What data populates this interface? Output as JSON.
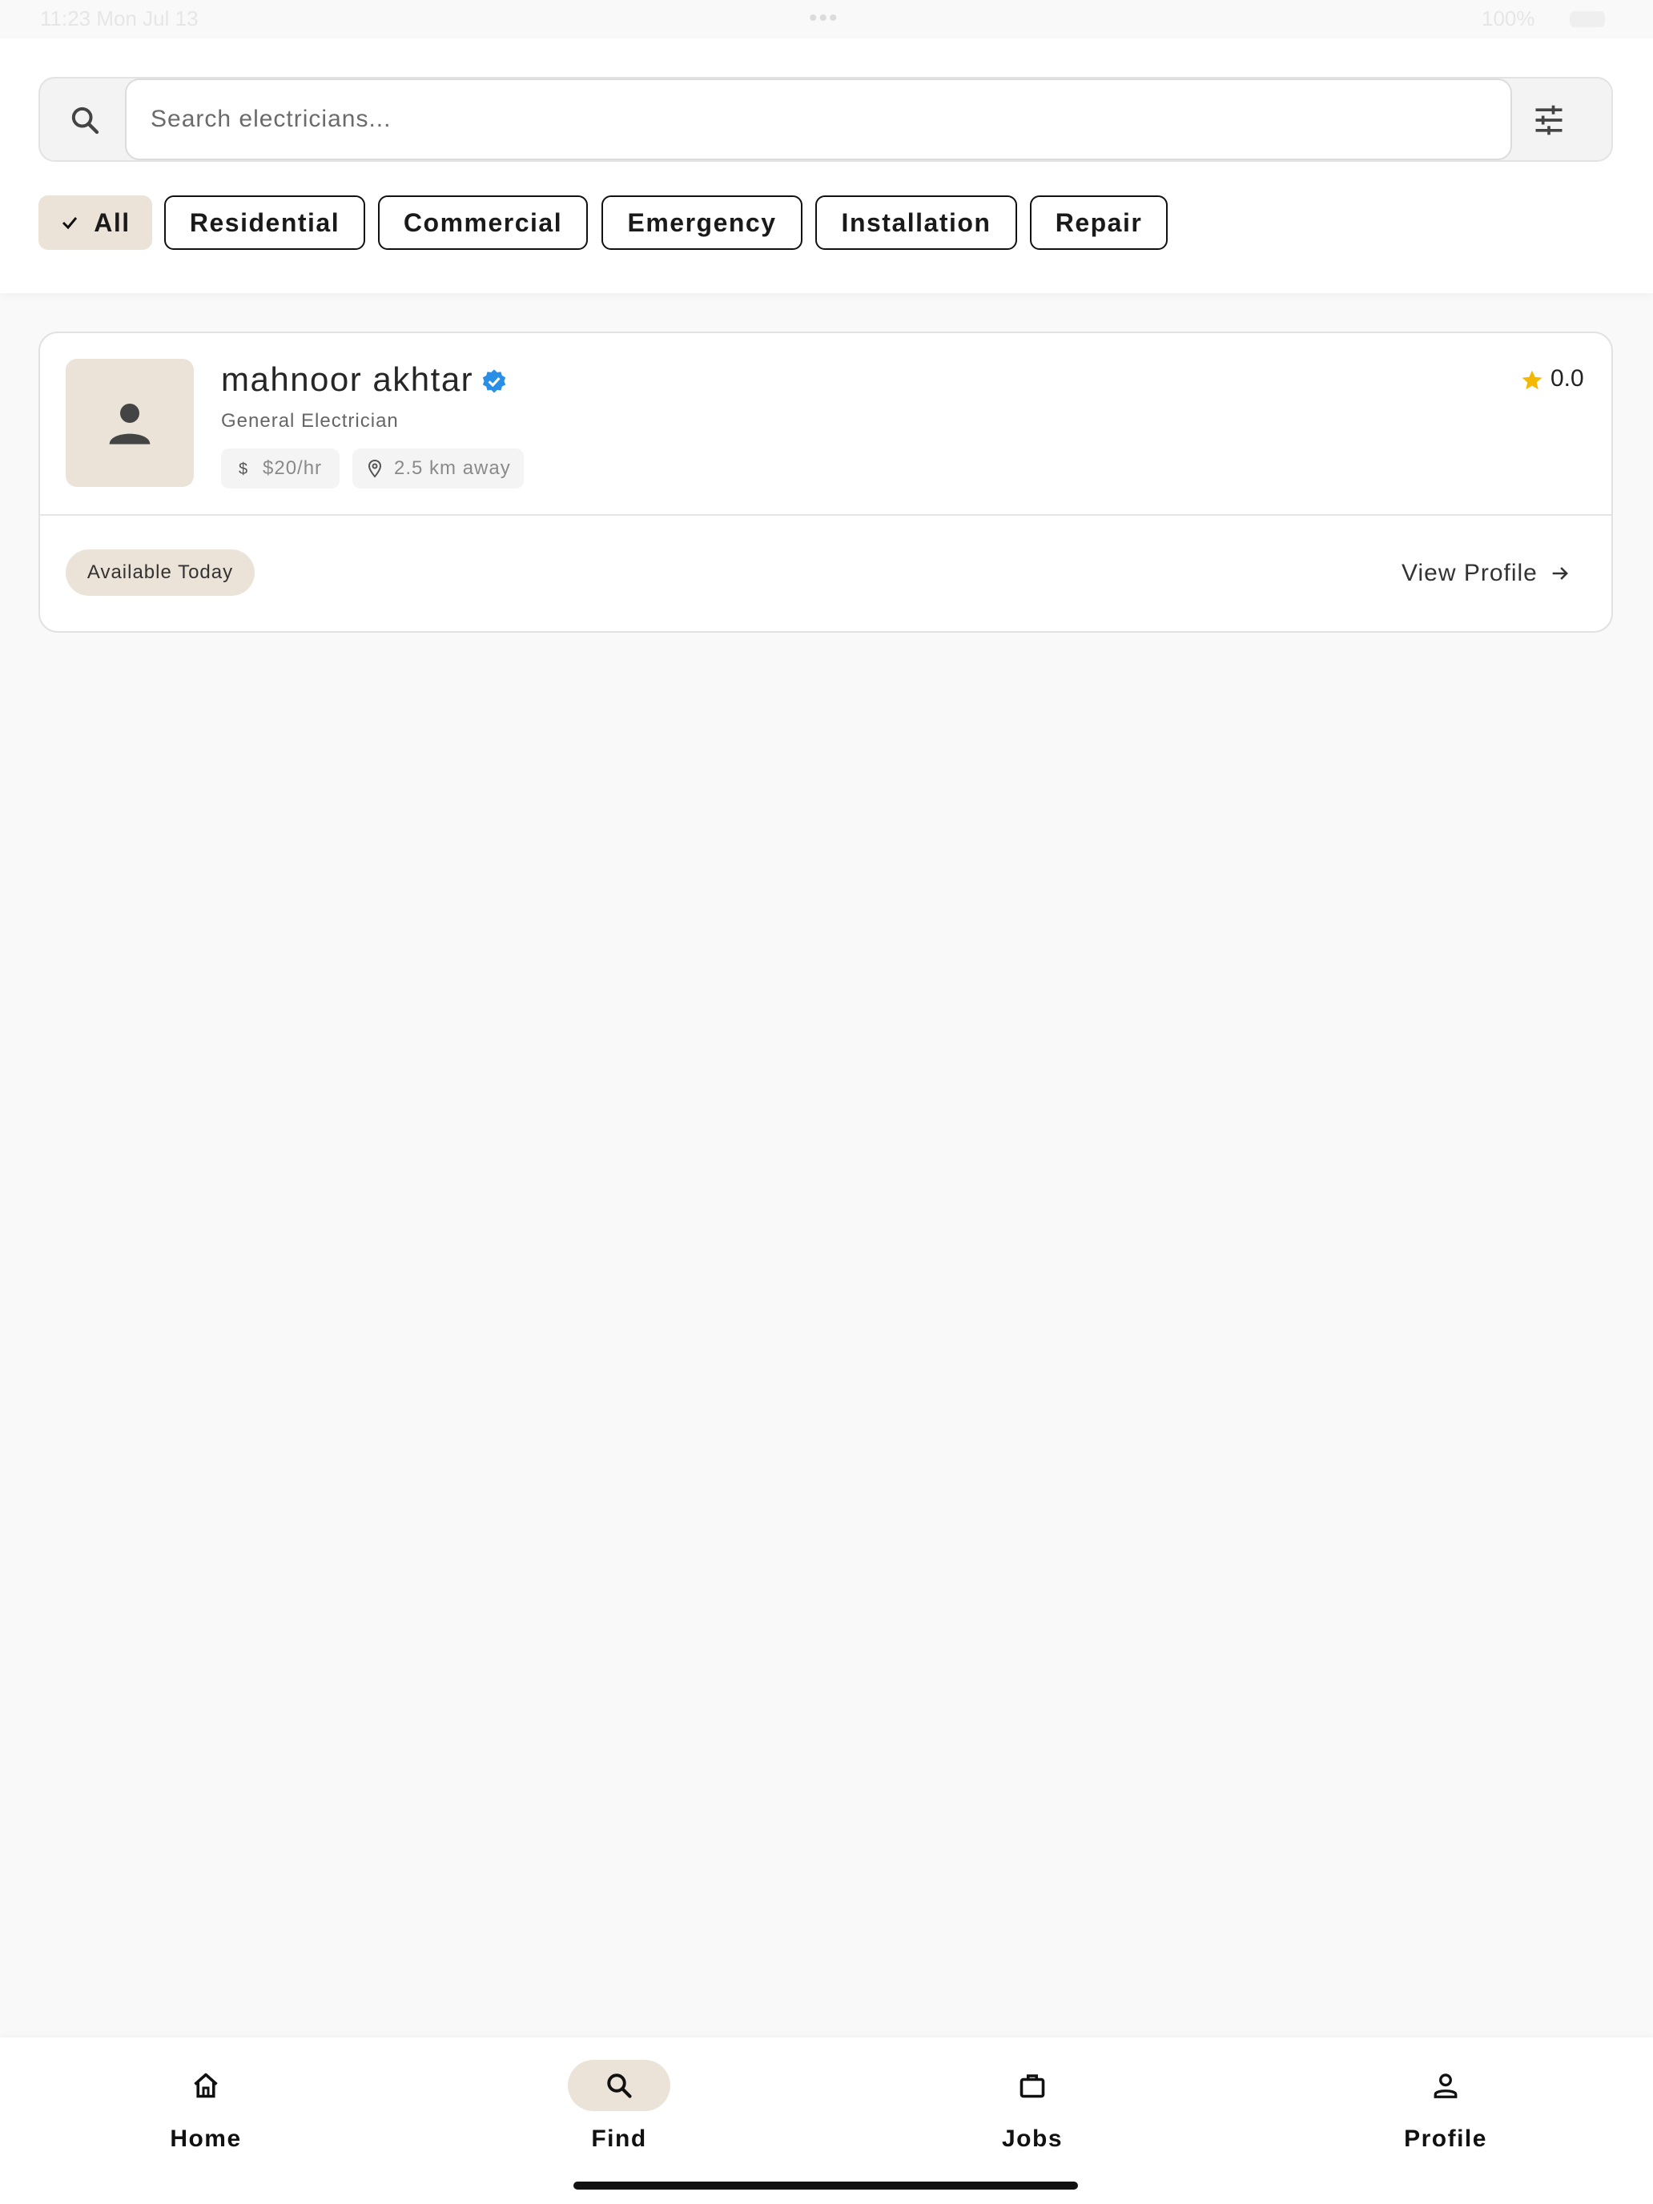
{
  "status_bar": {
    "time": "11:23 Mon Jul 13",
    "battery": "100%"
  },
  "search": {
    "placeholder": "Search electricians..."
  },
  "filters": {
    "chips": [
      "All",
      "Residential",
      "Commercial",
      "Emergency",
      "Installation",
      "Repair"
    ],
    "selected": "All"
  },
  "electrician": {
    "name": "mahnoor akhtar",
    "specialty": "General Electrician",
    "rating": "0.0",
    "rate": "$20/hr",
    "distance": "2.5 km away",
    "availability": "Available Today",
    "view_profile_label": "View Profile"
  },
  "nav": {
    "items": [
      {
        "label": "Home",
        "icon": "home-icon"
      },
      {
        "label": "Find",
        "icon": "search-icon"
      },
      {
        "label": "Jobs",
        "icon": "briefcase-icon"
      },
      {
        "label": "Profile",
        "icon": "person-icon"
      }
    ],
    "active": "Find"
  },
  "colors": {
    "accent": "#ece3d8",
    "verified": "#2a8ee6",
    "star": "#f5b800"
  }
}
